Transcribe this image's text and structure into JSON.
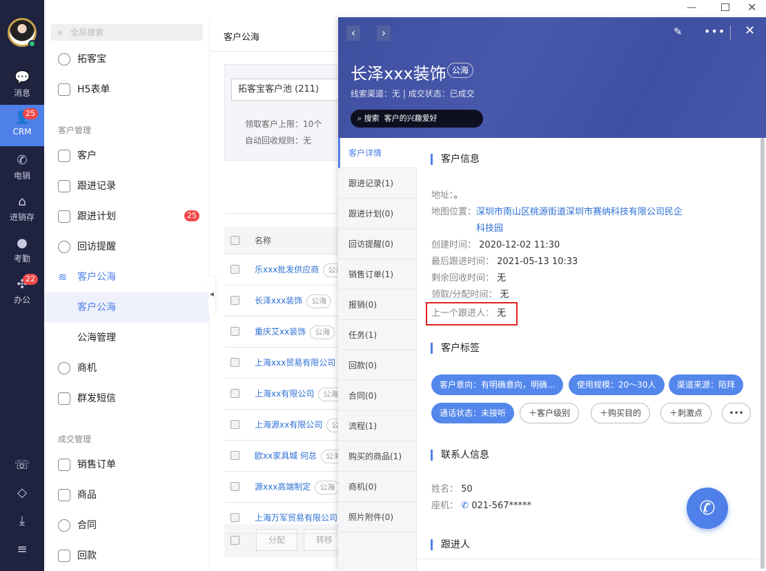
{
  "window": {
    "controls": [
      "minimize",
      "maximize",
      "close"
    ]
  },
  "rail": {
    "items": [
      {
        "label": "消息",
        "icon": "chat-icon"
      },
      {
        "label": "CRM",
        "icon": "user-icon",
        "badge": "25",
        "active": true
      },
      {
        "label": "电销",
        "icon": "phone-icon"
      },
      {
        "label": "进销存",
        "icon": "warehouse-icon"
      },
      {
        "label": "考勤",
        "icon": "location-icon"
      },
      {
        "label": "办公",
        "icon": "apps-icon",
        "badge": "22"
      }
    ],
    "bottom_icons": [
      "phone-settings-icon",
      "diamond-icon",
      "download-icon",
      "menu-icon"
    ]
  },
  "nav": {
    "search_placeholder": "全局搜索",
    "top_items": [
      {
        "label": "拓客宝"
      },
      {
        "label": "H5表单"
      }
    ],
    "sections": [
      {
        "title": "客户管理",
        "items": [
          {
            "label": "客户"
          },
          {
            "label": "跟进记录"
          },
          {
            "label": "跟进计划",
            "badge": "25"
          },
          {
            "label": "回访提醒"
          },
          {
            "label": "客户公海",
            "expanded": true
          },
          {
            "label": "客户公海",
            "sub": true,
            "selected": true
          },
          {
            "label": "公海管理",
            "sub": true
          },
          {
            "label": "商机"
          },
          {
            "label": "群发短信"
          }
        ]
      },
      {
        "title": "成交管理",
        "items": [
          {
            "label": "销售订单"
          },
          {
            "label": "商品"
          },
          {
            "label": "合同"
          },
          {
            "label": "回款"
          }
        ]
      }
    ]
  },
  "list": {
    "title": "客户公海",
    "pool_select": "拓客宝客户池 (211)",
    "limit": "领取客户上限：10个",
    "rule": "自动回收规则：无",
    "column": "名称",
    "rows": [
      {
        "name": "乐xxx批发供应商",
        "tag": "公海"
      },
      {
        "name": "长泽xxx装饰",
        "tag": "公海"
      },
      {
        "name": "重庆艾xx装饰",
        "tag": "公海"
      },
      {
        "name": "上海xxx贸易有限公司",
        "tag": ""
      },
      {
        "name": "上海xx有限公司",
        "tag": "公海"
      },
      {
        "name": "上海源xx有限公司",
        "tag": "公海"
      },
      {
        "name": "欧xx家具城 何总",
        "tag": "公海"
      },
      {
        "name": "源xxx高端制定",
        "tag": "公海"
      },
      {
        "name": "上海万军贸易有限公司",
        "tag": ""
      }
    ],
    "assign": "分配",
    "transfer": "转移"
  },
  "detail": {
    "title": "长泽xxx装饰",
    "tag": "公海",
    "subtitle": "线索渠道：无 | 成交状态：已成交",
    "search_label": "搜索",
    "search_hint": "客户的兴趣爱好",
    "tabs": [
      "客户详情",
      "跟进记录(1)",
      "跟进计划(0)",
      "回访提醒(0)",
      "销售订单(1)",
      "报销(0)",
      "任务(1)",
      "回款(0)",
      "合同(0)",
      "流程(1)",
      "购买的商品(1)",
      "商机(0)",
      "照片附件(0)"
    ],
    "info_title": "客户信息",
    "info": {
      "address_label": "地址：",
      "address": "。",
      "map_label": "地图位置：",
      "map_line1": "深圳市南山区桃源街道深圳市赛纳科技有限公司民企",
      "map_line2": "科技园",
      "created_label": "创建时间：",
      "created": "2020-12-02 11:30",
      "last_follow_label": "最后跟进时间：",
      "last_follow": "2021-05-13 10:33",
      "recycle_label": "剩余回收时间：",
      "recycle": "无",
      "claim_label": "领取/分配时间：",
      "claim": "无",
      "prev_label": "上一个跟进人：",
      "prev": "无"
    },
    "tags_title": "客户标签",
    "tags": [
      "客户意向：有明确意向，明确...",
      "使用规模：20～30人",
      "渠道来源：陌拜",
      "通话状态：未接听"
    ],
    "add_tags": [
      "客户级别",
      "购买目的",
      "刺激点"
    ],
    "contact_title": "联系人信息",
    "contact": {
      "name_label": "姓名：",
      "name": "50",
      "phone_label": "座机：",
      "phone": "021-567*****"
    },
    "follower_title": "跟进人"
  },
  "colors": {
    "accent": "#4f7fe8",
    "rail": "#1f2340",
    "header": "#3f50a2",
    "highlight": "#e02020"
  }
}
